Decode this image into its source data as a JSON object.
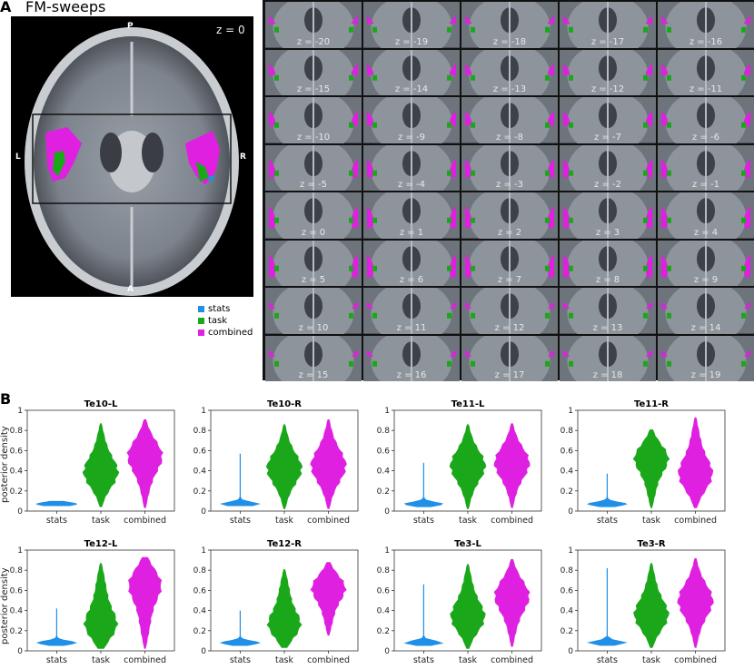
{
  "panel_a": {
    "letter": "A",
    "title": "FM-sweeps",
    "z_label": "z = 0",
    "orient": {
      "top": "P",
      "bottom": "A",
      "left": "L",
      "right": "R"
    },
    "slices": [
      "z = -20",
      "z = -19",
      "z = -18",
      "z = -17",
      "z = -16",
      "z = -15",
      "z = -14",
      "z = -13",
      "z = -12",
      "z = -11",
      "z = -10",
      "z = -9",
      "z = -8",
      "z = -7",
      "z = -6",
      "z = -5",
      "z = -4",
      "z = -3",
      "z = -2",
      "z = -1",
      "z = 0",
      "z = 1",
      "z = 2",
      "z = 3",
      "z = 4",
      "z = 5",
      "z = 6",
      "z = 7",
      "z = 8",
      "z = 9",
      "z = 10",
      "z = 11",
      "z = 12",
      "z = 13",
      "z = 14",
      "z = 15",
      "z = 16",
      "z = 17",
      "z = 18",
      "z = 19"
    ]
  },
  "legend": [
    {
      "label": "stats",
      "color": "#1f8fe8"
    },
    {
      "label": "task",
      "color": "#1aa81a"
    },
    {
      "label": "combined",
      "color": "#e020e0"
    }
  ],
  "panel_b": {
    "letter": "B"
  },
  "chart_data": [
    {
      "type": "violin",
      "title": "Te10-L",
      "ylabel": "posterior density",
      "ylim": [
        0,
        1
      ],
      "yticks": [
        "0",
        "0.2",
        "0.4",
        "0.6",
        "0.8",
        "1"
      ],
      "categories": [
        "stats",
        "task",
        "combined"
      ],
      "series": [
        {
          "name": "stats",
          "min": 0.05,
          "max": 0.1,
          "center": 0.07
        },
        {
          "name": "task",
          "min": 0.04,
          "max": 0.87,
          "center": 0.38
        },
        {
          "name": "combined",
          "min": 0.03,
          "max": 0.91,
          "center": 0.55
        }
      ]
    },
    {
      "type": "violin",
      "title": "Te10-R",
      "ylim": [
        0,
        1
      ],
      "yticks": [
        "0",
        "0.2",
        "0.4",
        "0.6",
        "0.8",
        "1"
      ],
      "categories": [
        "stats",
        "task",
        "combined"
      ],
      "series": [
        {
          "name": "stats",
          "min": 0.05,
          "max": 0.57,
          "center": 0.07
        },
        {
          "name": "task",
          "min": 0.02,
          "max": 0.86,
          "center": 0.42
        },
        {
          "name": "combined",
          "min": 0.02,
          "max": 0.91,
          "center": 0.45
        }
      ]
    },
    {
      "type": "violin",
      "title": "Te11-L",
      "ylim": [
        0,
        1
      ],
      "yticks": [
        "0",
        "0.2",
        "0.4",
        "0.6",
        "0.8",
        "1"
      ],
      "categories": [
        "stats",
        "task",
        "combined"
      ],
      "series": [
        {
          "name": "stats",
          "min": 0.04,
          "max": 0.48,
          "center": 0.07
        },
        {
          "name": "task",
          "min": 0.02,
          "max": 0.86,
          "center": 0.45
        },
        {
          "name": "combined",
          "min": 0.03,
          "max": 0.87,
          "center": 0.48
        }
      ]
    },
    {
      "type": "violin",
      "title": "Te11-R",
      "ylim": [
        0,
        1
      ],
      "yticks": [
        "0",
        "0.2",
        "0.4",
        "0.6",
        "0.8",
        "1"
      ],
      "categories": [
        "stats",
        "task",
        "combined"
      ],
      "series": [
        {
          "name": "stats",
          "min": 0.04,
          "max": 0.37,
          "center": 0.07
        },
        {
          "name": "task",
          "min": 0.03,
          "max": 0.81,
          "center": 0.53
        },
        {
          "name": "combined",
          "min": 0.03,
          "max": 0.93,
          "center": 0.36
        }
      ]
    },
    {
      "type": "violin",
      "title": "Te12-L",
      "ylabel": "posterior density",
      "ylim": [
        0,
        1
      ],
      "yticks": [
        "0",
        "0.2",
        "0.4",
        "0.6",
        "0.8",
        "1"
      ],
      "categories": [
        "stats",
        "task",
        "combined"
      ],
      "series": [
        {
          "name": "stats",
          "min": 0.05,
          "max": 0.42,
          "center": 0.08
        },
        {
          "name": "task",
          "min": 0.02,
          "max": 0.87,
          "center": 0.25
        },
        {
          "name": "combined",
          "min": 0.02,
          "max": 0.93,
          "center": 0.67
        }
      ]
    },
    {
      "type": "violin",
      "title": "Te12-R",
      "ylim": [
        0,
        1
      ],
      "yticks": [
        "0",
        "0.2",
        "0.4",
        "0.6",
        "0.8",
        "1"
      ],
      "categories": [
        "stats",
        "task",
        "combined"
      ],
      "series": [
        {
          "name": "stats",
          "min": 0.05,
          "max": 0.4,
          "center": 0.08
        },
        {
          "name": "task",
          "min": 0.03,
          "max": 0.81,
          "center": 0.25
        },
        {
          "name": "combined",
          "min": 0.15,
          "max": 0.88,
          "center": 0.63
        }
      ]
    },
    {
      "type": "violin",
      "title": "Te3-L",
      "ylim": [
        0,
        1
      ],
      "yticks": [
        "0",
        "0.2",
        "0.4",
        "0.6",
        "0.8",
        "1"
      ],
      "categories": [
        "stats",
        "task",
        "combined"
      ],
      "series": [
        {
          "name": "stats",
          "min": 0.05,
          "max": 0.66,
          "center": 0.08
        },
        {
          "name": "task",
          "min": 0.02,
          "max": 0.86,
          "center": 0.33
        },
        {
          "name": "combined",
          "min": 0.04,
          "max": 0.91,
          "center": 0.55
        }
      ]
    },
    {
      "type": "violin",
      "title": "Te3-R",
      "ylim": [
        0,
        1
      ],
      "yticks": [
        "0",
        "0.2",
        "0.4",
        "0.6",
        "0.8",
        "1"
      ],
      "categories": [
        "stats",
        "task",
        "combined"
      ],
      "series": [
        {
          "name": "stats",
          "min": 0.05,
          "max": 0.82,
          "center": 0.08
        },
        {
          "name": "task",
          "min": 0.03,
          "max": 0.87,
          "center": 0.35
        },
        {
          "name": "combined",
          "min": 0.03,
          "max": 0.92,
          "center": 0.5
        }
      ]
    }
  ]
}
